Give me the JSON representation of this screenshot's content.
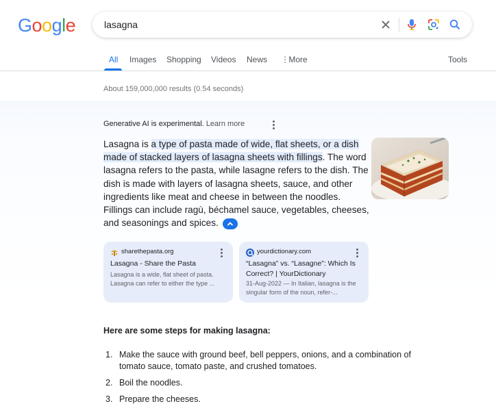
{
  "header": {
    "logo_letters": [
      {
        "char": "G",
        "color": "#4285F4"
      },
      {
        "char": "o",
        "color": "#EA4335"
      },
      {
        "char": "o",
        "color": "#FBBC05"
      },
      {
        "char": "g",
        "color": "#4285F4"
      },
      {
        "char": "l",
        "color": "#34A853"
      },
      {
        "char": "e",
        "color": "#EA4335"
      }
    ],
    "search_value": "lasagna",
    "icons": [
      "close-icon",
      "microphone-icon",
      "lens-icon",
      "search-icon"
    ]
  },
  "tabs": {
    "all": "All",
    "images": "Images",
    "shopping": "Shopping",
    "videos": "Videos",
    "news": "News",
    "more": "More",
    "tools": "Tools",
    "active": "all",
    "accent_color": "#1a73e8"
  },
  "result_stats": "About 159,000,000 results (0.54 seconds)",
  "ai_overview": {
    "experimental": "Generative AI is experimental.",
    "learn_more": "Learn more",
    "text_intro": "Lasagna is ",
    "text_highlight": "a type of pasta made of wide, flat sheets, or a dish made of stacked layers of lasagna sheets with fillings",
    "text_rest": ". The word lasagna refers to the pasta, while lasagne refers to the dish. The dish is made with layers of lasagna sheets, sauce, and other ingredients like meat and cheese in between the noodles. Fillings can include ragù, béchamel sauce, vegetables, cheeses, and seasonings and spices.",
    "sources": [
      {
        "site": "sharethepasta.org",
        "title": "Lasagna - Share the Pasta",
        "snippet": "Lasagna is a wide, flat sheet of pasta. Lasagna can refer to either the type ..."
      },
      {
        "site": "yourdictionary.com",
        "title": "“Lasagna” vs. “Lasagne”: Which Is Correct? | YourDictionary",
        "snippet": "31-Aug-2022 — In Italian, lasagna is the singular form of the noun, refer-..."
      }
    ],
    "steps_heading": "Here are some steps for making lasagna:",
    "steps": [
      {
        "num": "1.",
        "text": "Make the sauce with ground beef, bell peppers, onions, and a combination of tomato sauce, tomato paste, and crushed tomatoes."
      },
      {
        "num": "2.",
        "text": "Boil the noodles."
      },
      {
        "num": "3.",
        "text": "Prepare the cheeses."
      }
    ]
  }
}
